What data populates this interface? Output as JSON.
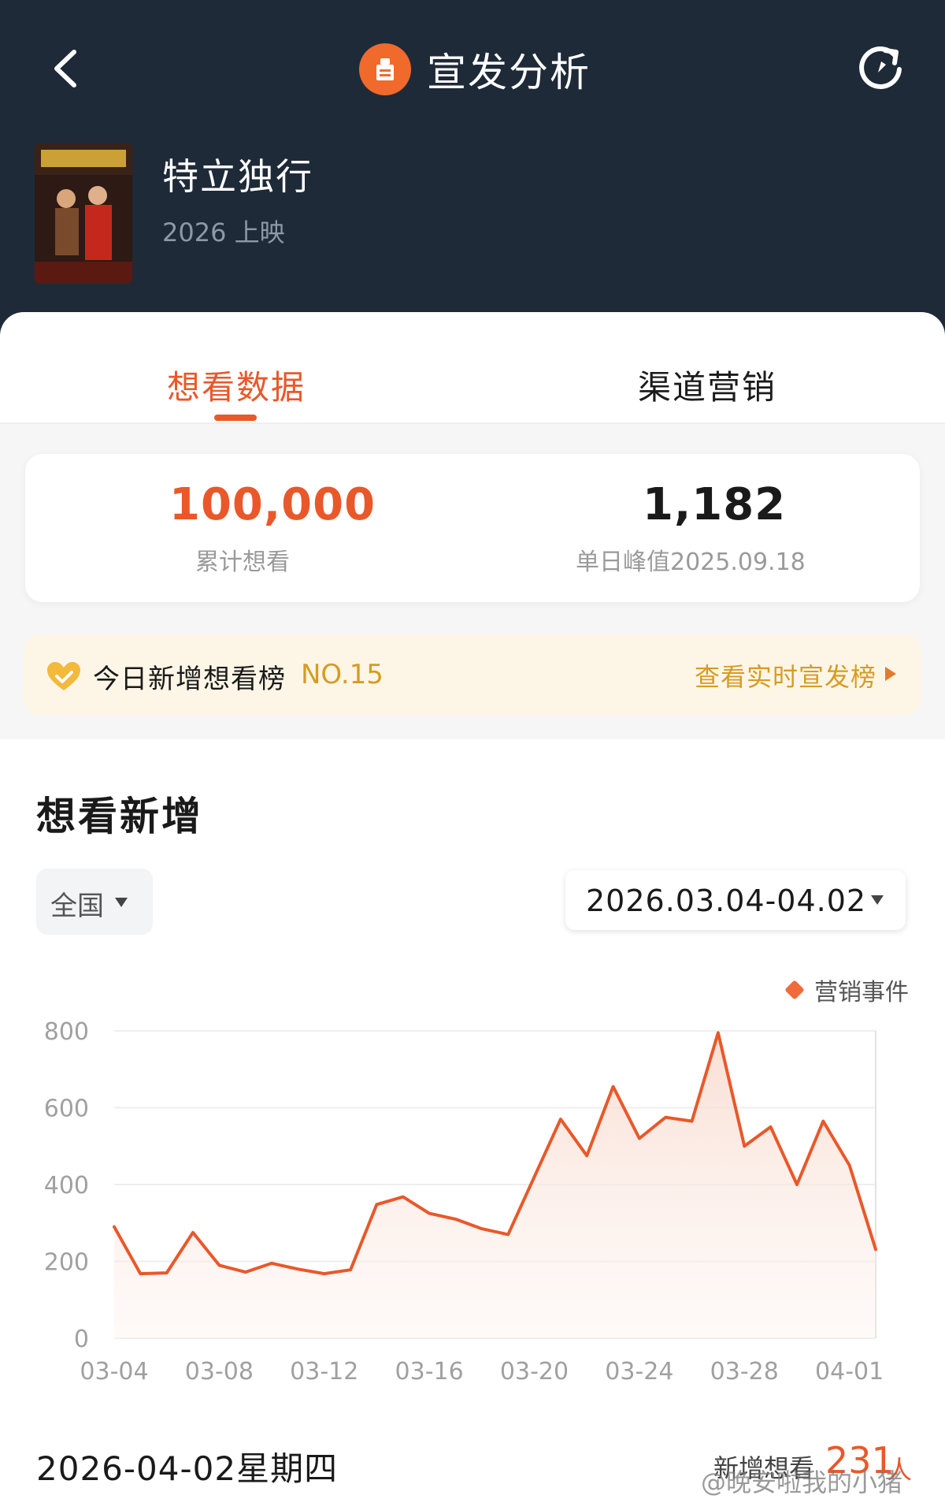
{
  "nav": {
    "title": "宣发分析"
  },
  "movie": {
    "title": "特立独行",
    "subtitle": "2026 上映"
  },
  "tabs": [
    {
      "label": "想看数据",
      "active": true
    },
    {
      "label": "渠道营销",
      "active": false
    }
  ],
  "stats": {
    "total_value": "100,000",
    "total_label": "累计想看",
    "peak_value": "1,182",
    "peak_label": "单日峰值2025.09.18"
  },
  "rank": {
    "text": "今日新增想看榜",
    "number": "NO.15",
    "link": "查看实时宣发榜"
  },
  "section": {
    "title": "想看新增",
    "region": "全国",
    "date_range": "2026.03.04-04.02",
    "legend": "营销事件"
  },
  "colors": {
    "accent": "#e9582a",
    "header_bg": "#1f2a38",
    "gold": "#d79b24"
  },
  "chart_data": {
    "type": "area",
    "x": [
      "03-04",
      "03-05",
      "03-06",
      "03-07",
      "03-08",
      "03-09",
      "03-10",
      "03-11",
      "03-12",
      "03-13",
      "03-14",
      "03-15",
      "03-16",
      "03-17",
      "03-18",
      "03-19",
      "03-20",
      "03-21",
      "03-22",
      "03-23",
      "03-24",
      "03-25",
      "03-26",
      "03-27",
      "03-28",
      "03-29",
      "03-30",
      "03-31",
      "04-01",
      "04-02"
    ],
    "series": [
      {
        "values": [
          290,
          168,
          170,
          275,
          190,
          172,
          195,
          180,
          168,
          178,
          348,
          368,
          325,
          310,
          285,
          270,
          420,
          570,
          475,
          655,
          520,
          575,
          565,
          795,
          500,
          550,
          400,
          565,
          450,
          231
        ]
      }
    ],
    "xticks": [
      "03-04",
      "03-08",
      "03-12",
      "03-16",
      "03-20",
      "03-24",
      "03-28",
      "04-01"
    ],
    "yticks": [
      0,
      200,
      400,
      600,
      800
    ],
    "ylim": [
      0,
      800
    ],
    "grid": true,
    "legend": "top-right"
  },
  "footer": {
    "date": "2026-04-02星期四",
    "label": "新增想看",
    "value": "231",
    "unit": "人",
    "watermark": "@晚安啦我的小猪"
  }
}
